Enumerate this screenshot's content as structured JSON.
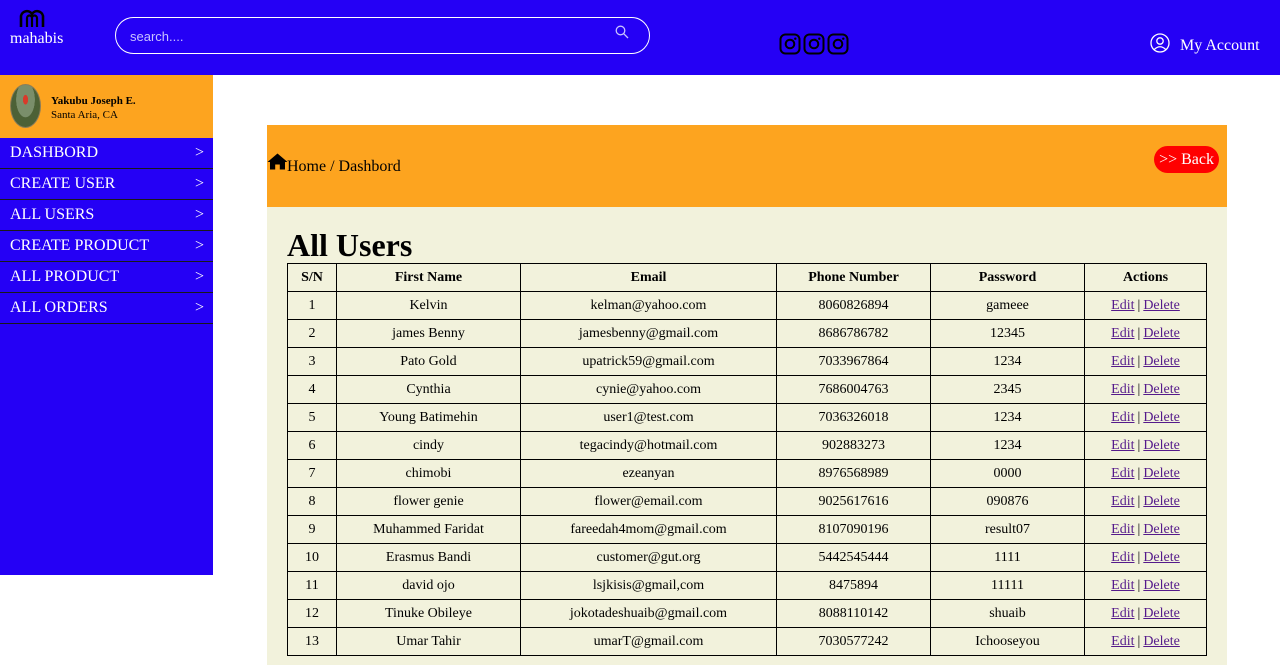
{
  "header": {
    "logo_text": "mahabis",
    "search_placeholder": "search....",
    "account_label": "My Account"
  },
  "sidebar": {
    "profile_name": "Yakubu Joseph E.",
    "profile_location": "Santa Aria, CA",
    "items": [
      {
        "label": "DASHBORD",
        "chevron": ">"
      },
      {
        "label": "CREATE USER",
        "chevron": ">"
      },
      {
        "label": "ALL USERS",
        "chevron": ">"
      },
      {
        "label": "CREATE PRODUCT",
        "chevron": ">"
      },
      {
        "label": "ALL PRODUCT",
        "chevron": ">"
      },
      {
        "label": "ALL ORDERS",
        "chevron": ">"
      }
    ]
  },
  "main": {
    "breadcrumb": "Home / Dashbord",
    "back_label": ">> Back",
    "title": "All Users",
    "columns": [
      "S/N",
      "First Name",
      "Email",
      "Phone Number",
      "Password",
      "Actions"
    ],
    "edit_label": "Edit",
    "separator": "|",
    "delete_label": "Delete",
    "rows": [
      [
        "1",
        "Kelvin",
        "kelman@yahoo.com",
        "8060826894",
        "gameee"
      ],
      [
        "2",
        "james Benny",
        "jamesbenny@gmail.com",
        "8686786782",
        "12345"
      ],
      [
        "3",
        "Pato Gold",
        "upatrick59@gmail.com",
        "7033967864",
        "1234"
      ],
      [
        "4",
        "Cynthia",
        "cynie@yahoo.com",
        "7686004763",
        "2345"
      ],
      [
        "5",
        "Young Batimehin",
        "user1@test.com",
        "7036326018",
        "1234"
      ],
      [
        "6",
        "cindy",
        "tegacindy@hotmail.com",
        "902883273",
        "1234"
      ],
      [
        "7",
        "chimobi",
        "ezeanyan",
        "8976568989",
        "0000"
      ],
      [
        "8",
        "flower genie",
        "flower@email.com",
        "9025617616",
        "090876"
      ],
      [
        "9",
        "Muhammed Faridat",
        "fareedah4mom@gmail.com",
        "8107090196",
        "result07"
      ],
      [
        "10",
        "Erasmus Bandi",
        "customer@gut.org",
        "5442545444",
        "1111"
      ],
      [
        "11",
        "david ojo",
        "lsjkisis@gmail,com",
        "8475894",
        "11111"
      ],
      [
        "12",
        "Tinuke Obileye",
        "jokotadeshuaib@gmail.com",
        "8088110142",
        "shuaib"
      ],
      [
        "13",
        "Umar Tahir",
        "umarT@gmail.com",
        "7030577242",
        "Ichooseyou"
      ]
    ]
  }
}
